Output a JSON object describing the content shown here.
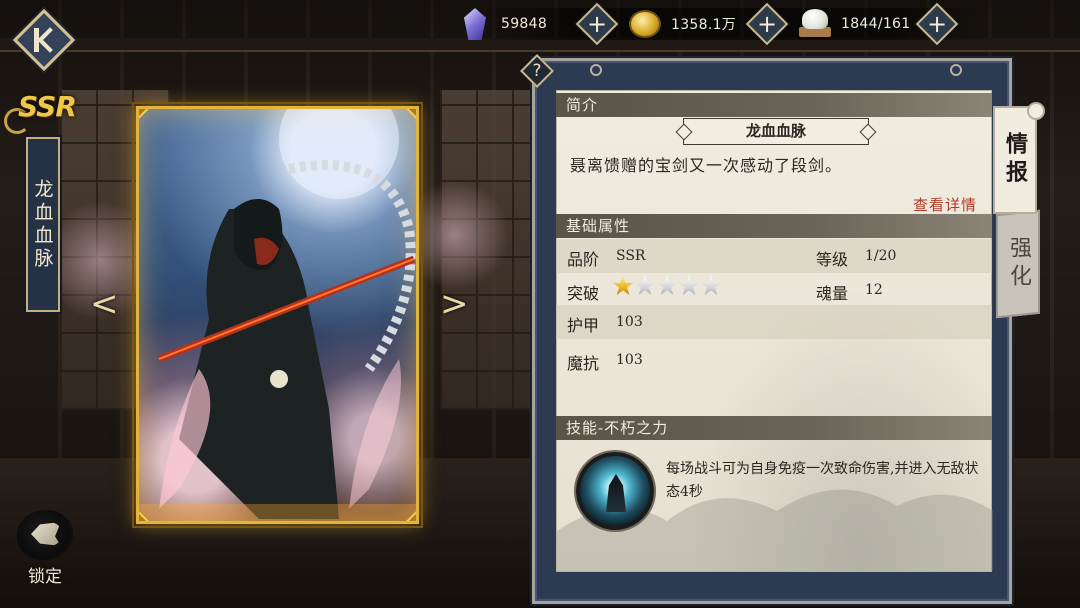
{
  "resources": [
    {
      "icon": "crystal-icon",
      "value": "59848"
    },
    {
      "icon": "gold-coin-icon",
      "value": "1358.1万"
    },
    {
      "icon": "steamed-bun-icon",
      "value": "1844/161"
    }
  ],
  "item": {
    "rarity": "SSR",
    "name": "龙血血脉",
    "lock_label": "锁定"
  },
  "panel": {
    "help_label": "?",
    "intro_header": "简介",
    "title": "龙血血脉",
    "description": "聂离馈赠的宝剑又一次感动了段剑。",
    "detail_link": "查看详情",
    "attr_header": "基础属性",
    "attributes": {
      "grade_label": "品阶",
      "grade_value": "SSR",
      "level_label": "等级",
      "level_value": "1/20",
      "breakthrough_label": "突破",
      "breakthrough_stars": 1,
      "breakthrough_max": 5,
      "soul_label": "魂量",
      "soul_value": "12",
      "armor_label": "护甲",
      "armor_value": "103",
      "resist_label": "魔抗",
      "resist_value": "103"
    },
    "skill_header": "技能-不朽之力",
    "skill_text": "每场战斗可为自身免疫一次致命伤害,并进入无敌状态4秒"
  },
  "tabs": {
    "info": "情报",
    "enhance": "强化"
  },
  "nav": {
    "prev": "<",
    "next": ">"
  },
  "colors": {
    "accent_gold": "#e2b43c",
    "panel_navy": "#2c3a52",
    "paper": "#f1ece0",
    "link_red": "#b13a26"
  }
}
